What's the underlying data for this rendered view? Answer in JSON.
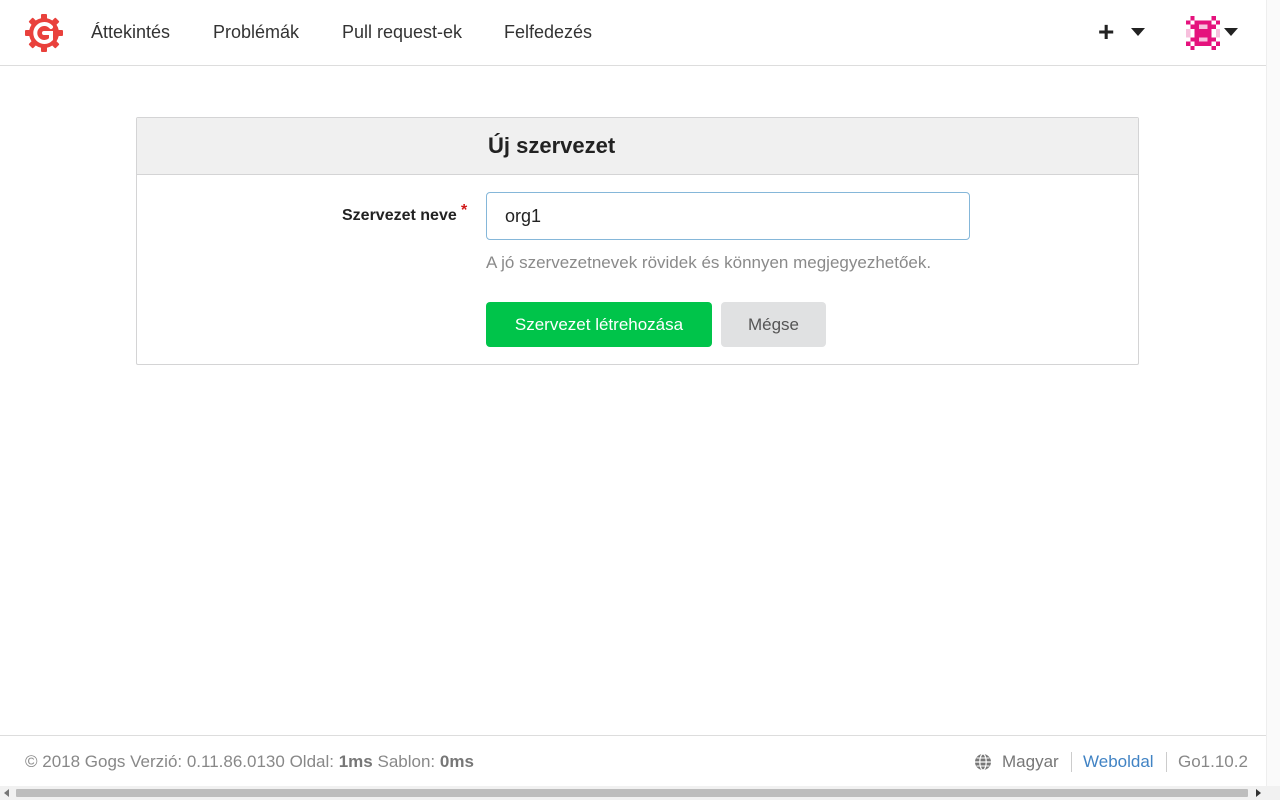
{
  "nav": {
    "logo_icon": "gogs-logo-icon",
    "items": [
      {
        "label": "Áttekintés"
      },
      {
        "label": "Problémák"
      },
      {
        "label": "Pull request-ek"
      },
      {
        "label": "Felfedezés"
      }
    ],
    "create_icon": "plus-icon",
    "dropdown_icon": "caret-down-icon"
  },
  "form": {
    "title": "Új szervezet",
    "org_name_label": "Szervezet neve",
    "required_mark": "*",
    "org_name_value": "org1",
    "org_name_help": "A jó szervezetnevek rövidek és könnyen megjegyezhetőek.",
    "submit_label": "Szervezet létrehozása",
    "cancel_label": "Mégse"
  },
  "footer": {
    "prefix": "© 2018 Gogs Verzió: 0.11.86.0130 Oldal:",
    "page_time": "1ms",
    "template_label": "Sablon:",
    "template_time": "0ms",
    "language": "Magyar",
    "website_link": "Weboldal",
    "go_version": "Go1.10.2"
  },
  "colors": {
    "primary_button": "#00c44a",
    "logo": "#e9413c",
    "link": "#4183c4",
    "avatar": "#e5127d"
  }
}
